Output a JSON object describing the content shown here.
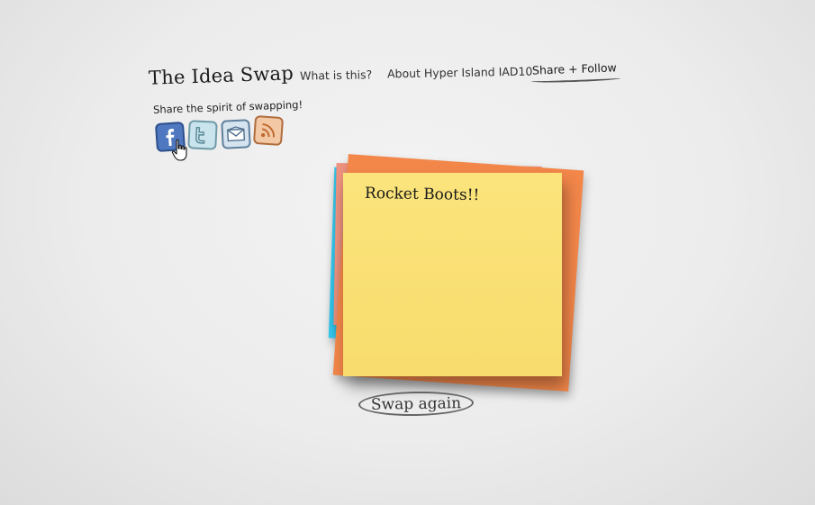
{
  "header": {
    "title": "The Idea Swap",
    "nav": [
      {
        "label": "What is this?"
      },
      {
        "label": "About Hyper Island IAD10"
      },
      {
        "label": "Share + Follow"
      }
    ]
  },
  "share": {
    "caption": "Share the spirit of swapping!",
    "icons": [
      "facebook-icon",
      "twitter-icon",
      "email-icon",
      "rss-icon"
    ]
  },
  "notes": {
    "current_idea": "Rocket Boots!!"
  },
  "actions": {
    "swap_again_label": "Swap again"
  },
  "colors": {
    "note_yellow": "#f8dc6d",
    "note_orange": "#f3874a",
    "note_pink": "#ef9380",
    "note_blue": "#36c8ee",
    "facebook": "#4f78c0",
    "twitter": "#c9e4ec",
    "email": "#d6e4f0",
    "rss": "#f2c8a5"
  }
}
